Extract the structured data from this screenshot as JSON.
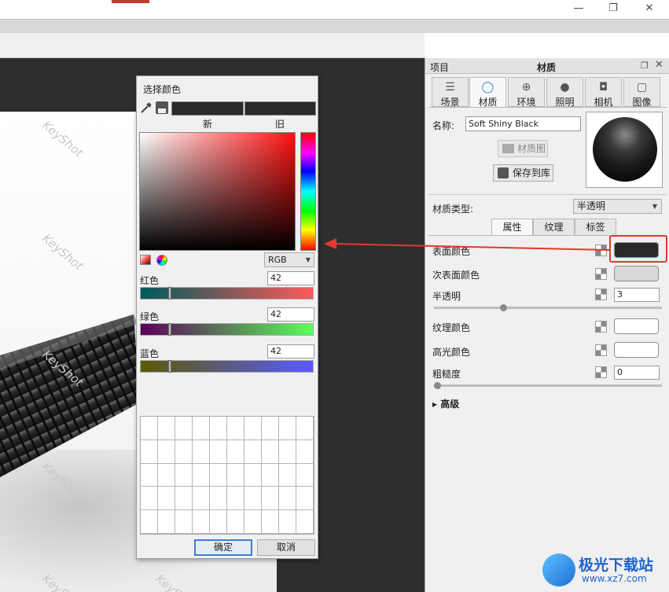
{
  "window": {
    "minimize": "—",
    "restore": "❐",
    "close": "✕"
  },
  "viewport": {
    "watermark": "KeyShot"
  },
  "color_dialog": {
    "title": "选择颜色",
    "new_label": "新",
    "old_label": "旧",
    "new_color": "#2a2a2a",
    "old_color": "#2a2a2a",
    "mode": "RGB",
    "channels": [
      {
        "label": "红色",
        "value": "42",
        "level": 0.165
      },
      {
        "label": "绿色",
        "value": "42",
        "level": 0.165
      },
      {
        "label": "蓝色",
        "value": "42",
        "level": 0.165
      }
    ],
    "ok": "确定",
    "cancel": "取消"
  },
  "panel": {
    "header_left": "项目",
    "header_title": "材质",
    "header_icons": [
      "restore-icon",
      "close-icon"
    ],
    "tabs": [
      {
        "label": "场景",
        "icon": "list-icon"
      },
      {
        "label": "材质",
        "icon": "material-sphere-icon"
      },
      {
        "label": "环境",
        "icon": "globe-icon"
      },
      {
        "label": "照明",
        "icon": "bulb-icon"
      },
      {
        "label": "相机",
        "icon": "camera-icon"
      },
      {
        "label": "图像",
        "icon": "image-icon"
      }
    ],
    "name_label": "名称:",
    "name_value": "Soft Shiny Black",
    "material_graph": "材质图",
    "save_to_library": "保存到库",
    "material_type_label": "材质类型:",
    "material_type_value": "半透明",
    "subtabs": [
      "属性",
      "纹理",
      "标签"
    ],
    "props": {
      "surface_color": "表面颜色",
      "subsurface_color": "次表面颜色",
      "translucency": "半透明",
      "translucency_value": "3",
      "texture_color": "纹理颜色",
      "specular_color": "高光颜色",
      "roughness": "粗糙度",
      "roughness_value": "0",
      "advanced": "高级"
    },
    "colors": {
      "surface": "#2a2a2a",
      "subsurface": "#d9d9d9",
      "texture": "#ffffff",
      "specular": "#ffffff"
    }
  },
  "logo": {
    "name": "极光下载站",
    "url": "www.xz7.com"
  }
}
